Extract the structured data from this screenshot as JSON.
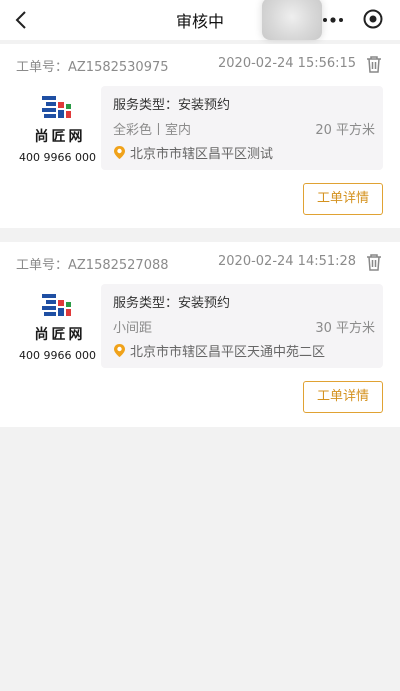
{
  "header": {
    "title": "审核中"
  },
  "orders": [
    {
      "order_no": "工单号：AZ1582530975",
      "time": "2020-02-24 15:56:15",
      "logo_title": "尚匠网",
      "logo_phone": "400 9966 000",
      "service": "服务类型：安装预约",
      "spec": "全彩色丨室内",
      "area": "20 平方米",
      "address": "北京市市辖区昌平区测试",
      "detail_label": "工单详情"
    },
    {
      "order_no": "工单号：AZ1582527088",
      "time": "2020-02-24 14:51:28",
      "logo_title": "尚匠网",
      "logo_phone": "400 9966 000",
      "service": "服务类型：安装预约",
      "spec": "小间距",
      "area": "30 平方米",
      "address": "北京市市辖区昌平区天通中苑二区",
      "detail_label": "工单详情"
    }
  ],
  "colors": {
    "accent": "#e0a233",
    "pin": "#f0a21a",
    "logo_blue": "#1f4fa3",
    "logo_red": "#e03a3a",
    "logo_green": "#2a9a45"
  }
}
